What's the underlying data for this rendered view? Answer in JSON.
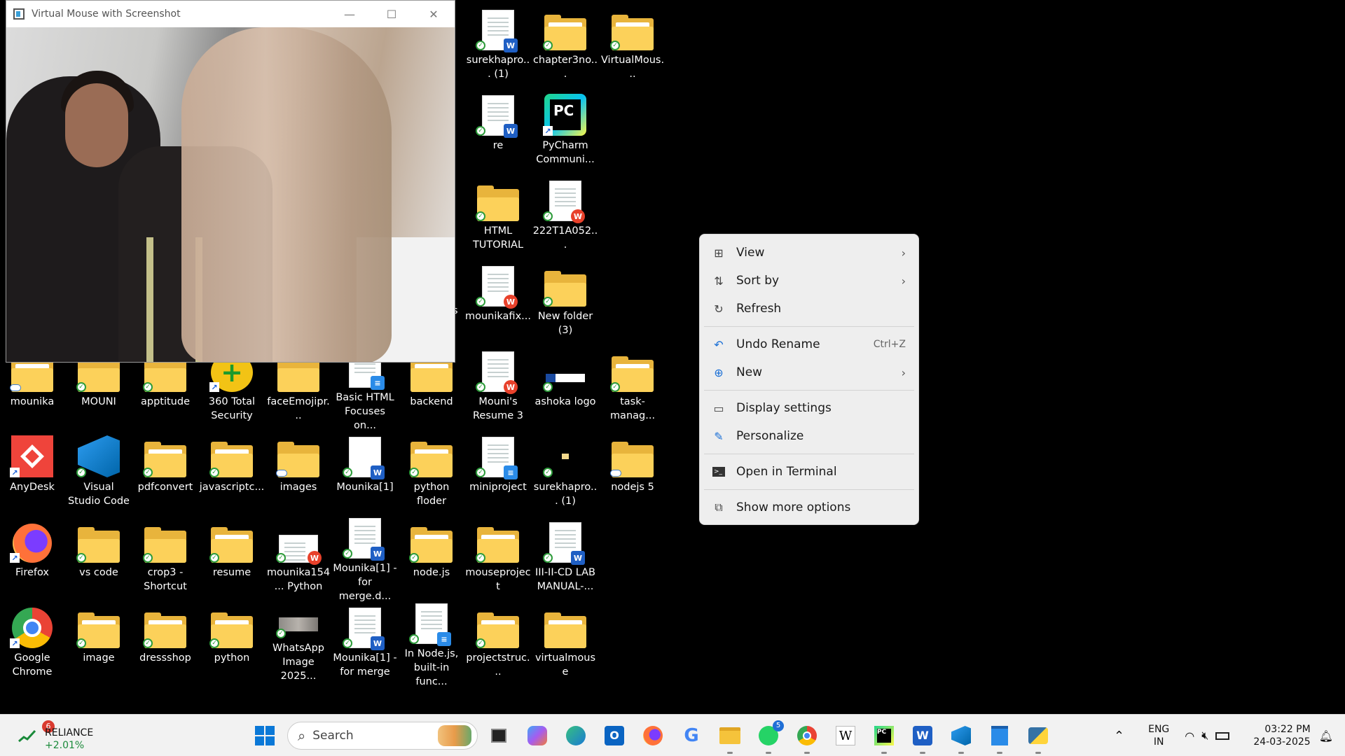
{
  "camera_window": {
    "title": "Virtual Mouse with Screenshot",
    "minimize_icon": "minimize-icon",
    "maximize_icon": "maximize-icon",
    "close_icon": "close-icon"
  },
  "desktop": {
    "icons": {
      "surekhapro_1_top": "surekhapro... (1)",
      "chapter3no": "chapter3no...",
      "virtualmous": "VirtualMous...",
      "re": "re",
      "pycharm": "PyCharm Communi...",
      "html_tutorial": "HTML TUTORIAL",
      "doc_222t1a052": "222T1A052...",
      "mounikafix": "mounikafix...",
      "new_folder_3": "New folder (3)",
      "mounika": "mounika",
      "mouni": "MOUNI",
      "apptitude": "apptitude",
      "total_security": "360 Total Security",
      "faceemojipr": "faceEmojipr...",
      "basic_html": "Basic HTML Focuses on...",
      "backend": "backend",
      "mounis_resume": "Mouni's Resume 3",
      "ashoka_logo": "ashoka logo",
      "task_manag": "task-manag...",
      "anydesk": "AnyDesk",
      "vscode_app": "Visual Studio Code",
      "pdfconvert": "pdfconvert",
      "javascriptc": "javascriptc...",
      "images": "images",
      "mounika1": "Mounika[1]",
      "python_floder": "python floder",
      "miniproject": "miniproject",
      "surekhapro_1_mid": "surekhapro... (1)",
      "nodejs5": "nodejs 5",
      "firefox": "Firefox",
      "vs_code_folder": "vs code",
      "crop3": "crop3 - Shortcut",
      "resume": "resume",
      "mounika154_python": "mounika154... Python",
      "mounika1_merge_d": "Mounika[1] - for merge.d...",
      "nodejs": "node.js",
      "mouseproject": "mouseproject",
      "cd_lab_manual": "III-II-CD LAB MANUAL-...",
      "google_chrome": "Google Chrome",
      "image": "image",
      "dressshop": "dressshop",
      "python": "python",
      "whatsapp_image": "WhatsApp Image 2025...",
      "mounika1_merge": "Mounika[1] - for merge",
      "in_nodejs": "In Node.js, built-in func...",
      "projectstruc": "projectstruc...",
      "virtualmouse": "virtualmouse",
      "partial_s": "s"
    }
  },
  "context_menu": {
    "view": "View",
    "sort_by": "Sort by",
    "refresh": "Refresh",
    "undo_rename": "Undo Rename",
    "undo_shortcut": "Ctrl+Z",
    "new": "New",
    "display_settings": "Display settings",
    "personalize": "Personalize",
    "open_terminal": "Open in Terminal",
    "show_more": "Show more options"
  },
  "taskbar": {
    "widget_badge": "6",
    "stock_name": "RELIANCE",
    "stock_change": "+2.01%",
    "search_placeholder": "Search",
    "whatsapp_badge": "5",
    "lang_top": "ENG",
    "lang_bottom": "IN",
    "time": "03:22 PM",
    "date": "24-03-2025"
  },
  "colors": {
    "folder": "#fcd15a",
    "word": "#1f5fc4",
    "wps": "#e8412b",
    "sync_green": "#2d9b3a",
    "stock_up": "#1a8a3a",
    "desktop_bg": "#000000"
  }
}
